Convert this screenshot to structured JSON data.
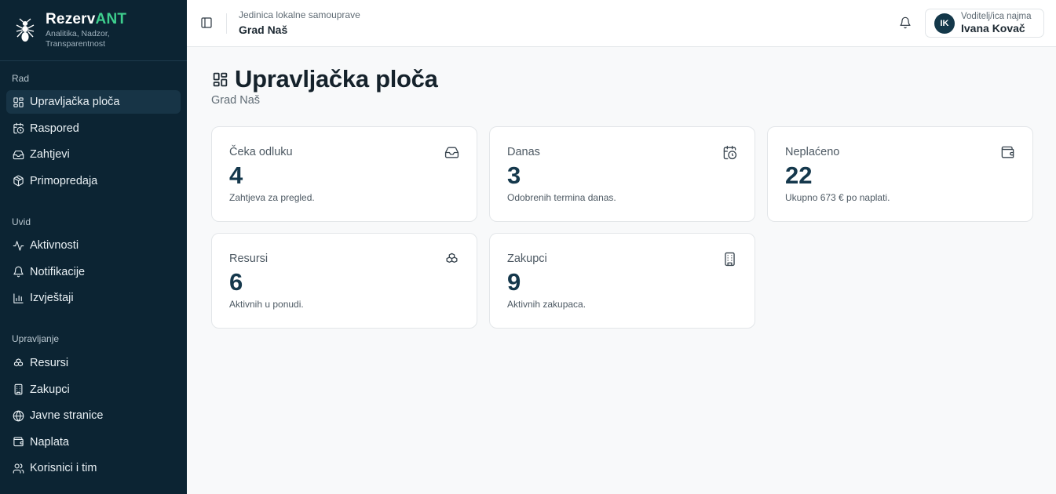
{
  "brand": {
    "name_main": "Rezerv",
    "name_accent": "ANT",
    "tagline": "Analitika, Nadzor, Transparentnost"
  },
  "sidebar": {
    "groups": [
      {
        "label": "Rad",
        "items": [
          {
            "label": "Upravljačka ploča",
            "icon": "dashboard-icon",
            "active": true
          },
          {
            "label": "Raspored",
            "icon": "calendar-clock-icon"
          },
          {
            "label": "Zahtjevi",
            "icon": "inbox-icon"
          },
          {
            "label": "Primopredaja",
            "icon": "package-icon"
          }
        ]
      },
      {
        "label": "Uvid",
        "items": [
          {
            "label": "Aktivnosti",
            "icon": "activity-icon"
          },
          {
            "label": "Notifikacije",
            "icon": "bell-icon"
          },
          {
            "label": "Izvještaji",
            "icon": "bar-chart-icon"
          }
        ]
      },
      {
        "label": "Upravljanje",
        "items": [
          {
            "label": "Resursi",
            "icon": "boxes-icon"
          },
          {
            "label": "Zakupci",
            "icon": "building-icon"
          },
          {
            "label": "Javne stranice",
            "icon": "globe-icon"
          },
          {
            "label": "Naplata",
            "icon": "wallet-icon"
          },
          {
            "label": "Korisnici i tim",
            "icon": "users-icon"
          }
        ]
      }
    ]
  },
  "header": {
    "org_subtitle": "Jedinica lokalne samouprave",
    "org_name": "Grad Naš",
    "user": {
      "initials": "IK",
      "role": "Voditelj/ica najma",
      "name": "Ivana Kovač"
    }
  },
  "main": {
    "title": "Upravljačka ploča",
    "subtitle": "Grad Naš",
    "cards": [
      {
        "label": "Čeka odluku",
        "value": "4",
        "desc": "Zahtjeva za pregled.",
        "icon": "inbox-icon"
      },
      {
        "label": "Danas",
        "value": "3",
        "desc": "Odobrenih termina danas.",
        "icon": "calendar-clock-icon"
      },
      {
        "label": "Neplaćeno",
        "value": "22",
        "desc": "Ukupno 673 € po naplati.",
        "icon": "wallet-icon"
      },
      {
        "label": "Resursi",
        "value": "6",
        "desc": "Aktivnih u ponudi.",
        "icon": "boxes-icon"
      },
      {
        "label": "Zakupci",
        "value": "9",
        "desc": "Aktivnih zakupaca.",
        "icon": "building-icon"
      }
    ]
  },
  "colors": {
    "sidebar_bg": "#0c2433",
    "sidebar_active": "#173446",
    "brand_accent": "#3ecf8e",
    "value_color": "#15384c"
  }
}
